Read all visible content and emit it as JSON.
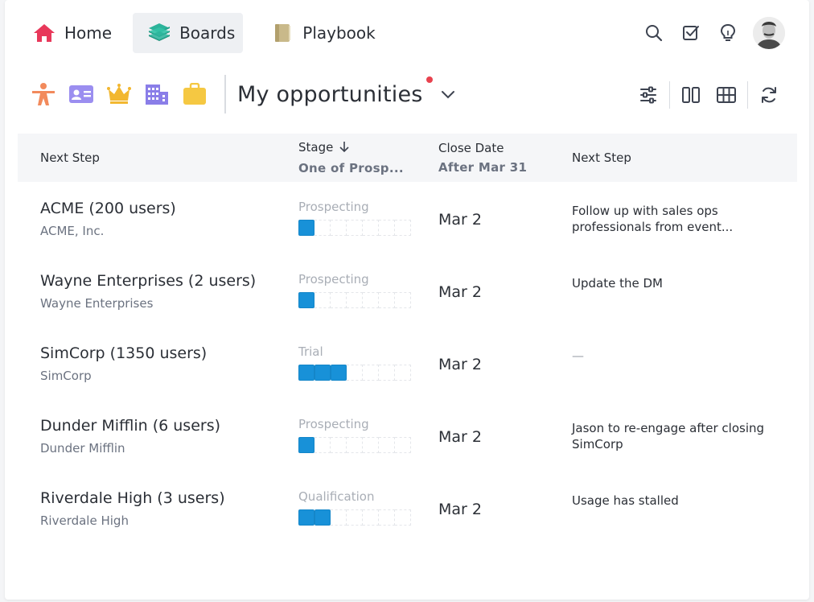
{
  "nav": {
    "items": [
      {
        "label": "Home",
        "icon": "home-icon",
        "color": "#e8385a"
      },
      {
        "label": "Boards",
        "icon": "layers-icon",
        "color": "#2bb39a",
        "active": true
      },
      {
        "label": "Playbook",
        "icon": "book-icon",
        "color": "#c9b98a"
      }
    ]
  },
  "top_tools": [
    "search-icon",
    "checkbox-icon",
    "lightbulb-icon",
    "avatar"
  ],
  "object_icons": [
    {
      "name": "person-icon",
      "color": "#f28a5c"
    },
    {
      "name": "contact-card-icon",
      "color": "#9b8ef0"
    },
    {
      "name": "crown-icon",
      "color": "#f2b730"
    },
    {
      "name": "building-icon",
      "color": "#8a7ee8"
    },
    {
      "name": "briefcase-icon",
      "color": "#f5c842"
    }
  ],
  "view": {
    "title": "My opportunities"
  },
  "view_tools": [
    "filter-sliders-icon",
    "columns-icon",
    "grid-icon",
    "refresh-icon"
  ],
  "table": {
    "headers": [
      {
        "label": "Next Step",
        "filter": ""
      },
      {
        "label": "Stage",
        "filter": "One of Prosp..."
      },
      {
        "label": "Close Date",
        "filter": "After Mar 31"
      },
      {
        "label": "Next Step",
        "filter": ""
      }
    ],
    "rows": [
      {
        "name": "ACME (200 users)",
        "account": "ACME, Inc.",
        "stage": "Prospecting",
        "stage_level": 1,
        "close_date": "Mar 2",
        "next_step": "Follow up with sales ops professionals from event..."
      },
      {
        "name": "Wayne Enterprises (2 users)",
        "account": "Wayne Enterprises",
        "stage": "Prospecting",
        "stage_level": 1,
        "close_date": "Mar 2",
        "next_step": "Update the DM"
      },
      {
        "name": "SimCorp (1350 users)",
        "account": "SimCorp",
        "stage": "Trial",
        "stage_level": 3,
        "close_date": "Mar 2",
        "next_step": "—"
      },
      {
        "name": "Dunder Mifflin (6 users)",
        "account": "Dunder Mifflin",
        "stage": "Prospecting",
        "stage_level": 1,
        "close_date": "Mar 2",
        "next_step": "Jason to re-engage after closing SimCorp"
      },
      {
        "name": "Riverdale High (3 users)",
        "account": "Riverdale High",
        "stage": "Qualification",
        "stage_level": 2,
        "close_date": "Mar 2",
        "next_step": "Usage has stalled"
      }
    ],
    "stage_segments": 7,
    "stage_color": "#1891d8"
  }
}
